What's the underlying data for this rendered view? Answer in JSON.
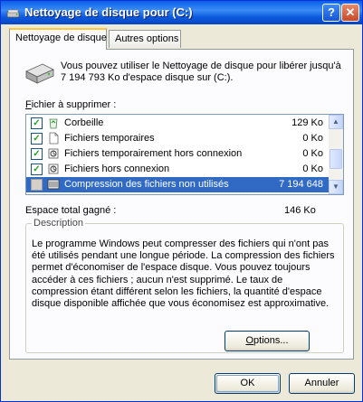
{
  "window": {
    "title": "Nettoyage de disque pour  (C:)",
    "help_label": "?",
    "close_label": "✕"
  },
  "tabs": [
    {
      "label": "Nettoyage de disque",
      "active": true
    },
    {
      "label": "Autres options",
      "active": false
    }
  ],
  "intro_text": "Vous pouvez utiliser le Nettoyage de disque pour libérer jusqu'à 7 194 793 Ko d'espace disque sur  (C:).",
  "files": {
    "label_prefix": "",
    "label_accel": "F",
    "label_rest": "ichier à supprimer :",
    "items": [
      {
        "name": "Corbeille",
        "size": "129 Ko",
        "checked": true,
        "icon": "recycle-bin-icon"
      },
      {
        "name": "Fichiers temporaires",
        "size": "0 Ko",
        "checked": true,
        "icon": "file-icon"
      },
      {
        "name": "Fichiers temporairement hors connexion",
        "size": "0 Ko",
        "checked": true,
        "icon": "offline-files-icon"
      },
      {
        "name": "Fichiers hors connexion",
        "size": "0 Ko",
        "checked": true,
        "icon": "offline-files-icon"
      },
      {
        "name": "Compression des fichiers non utilisés",
        "size": "7 194 648",
        "checked": false,
        "selected": true,
        "icon": "compress-icon"
      }
    ]
  },
  "total": {
    "label": "Espace total gagné :",
    "value": "146 Ko"
  },
  "description": {
    "legend": "Description",
    "text": "Le programme Windows peut compresser des fichiers qui n'ont pas été utilisés pendant une longue période. La compression des fichiers permet d'économiser de l'espace disque. Vous pouvez toujours accéder à ces fichiers ; aucun n'est supprimé. Le taux de compression étant différent selon les fichiers, la quantité d'espace disque disponible affichée que vous économisez est approximative."
  },
  "buttons": {
    "options_accel": "O",
    "options_rest": "ptions...",
    "ok": "OK",
    "cancel": "Annuler"
  },
  "colors": {
    "title_blue": "#0a5fe8",
    "selection": "#316ac5",
    "tab_highlight": "#ffc83c"
  }
}
